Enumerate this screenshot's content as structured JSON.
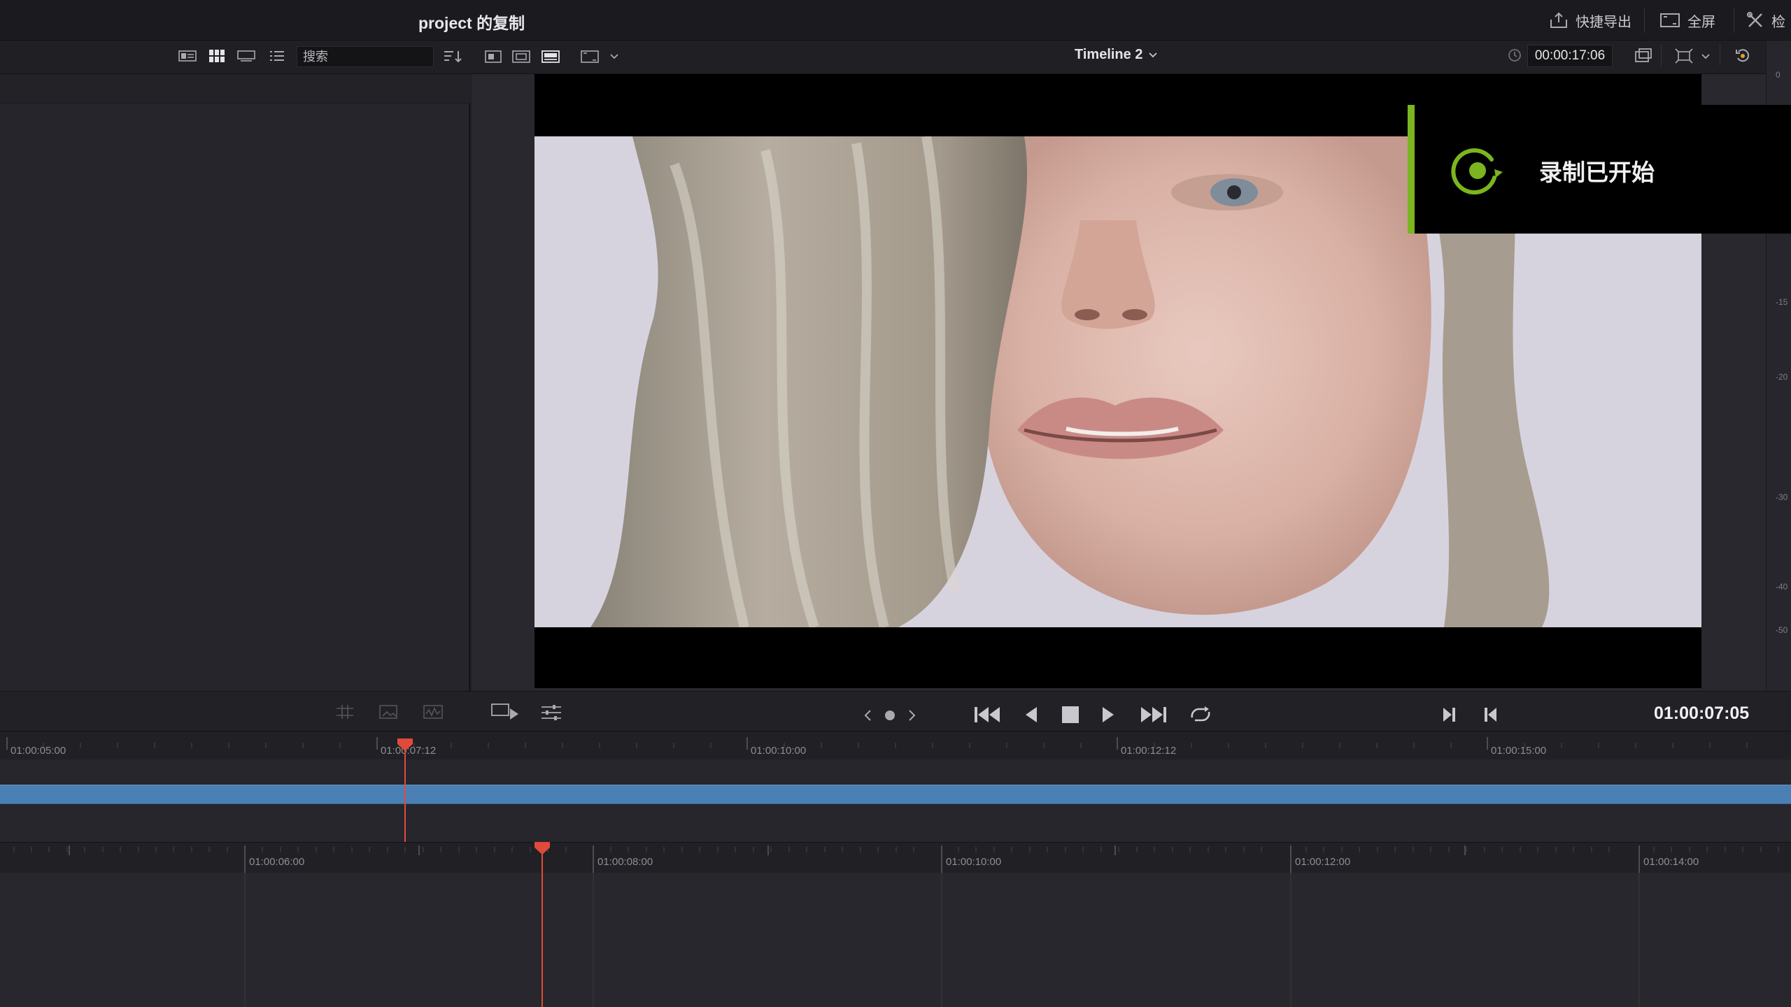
{
  "header": {
    "project_title": "project 的复制",
    "quick_export_label": "快捷导出",
    "fullscreen_label": "全屏",
    "inspector_label": "检"
  },
  "toolbar": {
    "search_placeholder": "搜索",
    "timeline_name": "Timeline 2",
    "timecode": "00:00:17:06"
  },
  "viewer": {
    "meter_labels": [
      "0",
      "-15",
      "-20",
      "-30",
      "-40",
      "-50"
    ]
  },
  "notification": {
    "message": "录制已开始",
    "accent_color": "#7bb51f"
  },
  "transport": {
    "current_timecode": "01:00:07:05"
  },
  "upper_timeline": {
    "ticks": [
      "01:00:05:00",
      "01:00:07:12",
      "01:00:10:00",
      "01:00:12:12",
      "01:00:15:00"
    ],
    "clip_color": "#4a80b3"
  },
  "lower_timeline": {
    "ticks": [
      "01:00:06:00",
      "01:00:08:00",
      "01:00:10:00",
      "01:00:12:00",
      "01:00:14:00"
    ]
  },
  "colors": {
    "playhead": "#e04a3a",
    "background": "#1f1f24"
  }
}
